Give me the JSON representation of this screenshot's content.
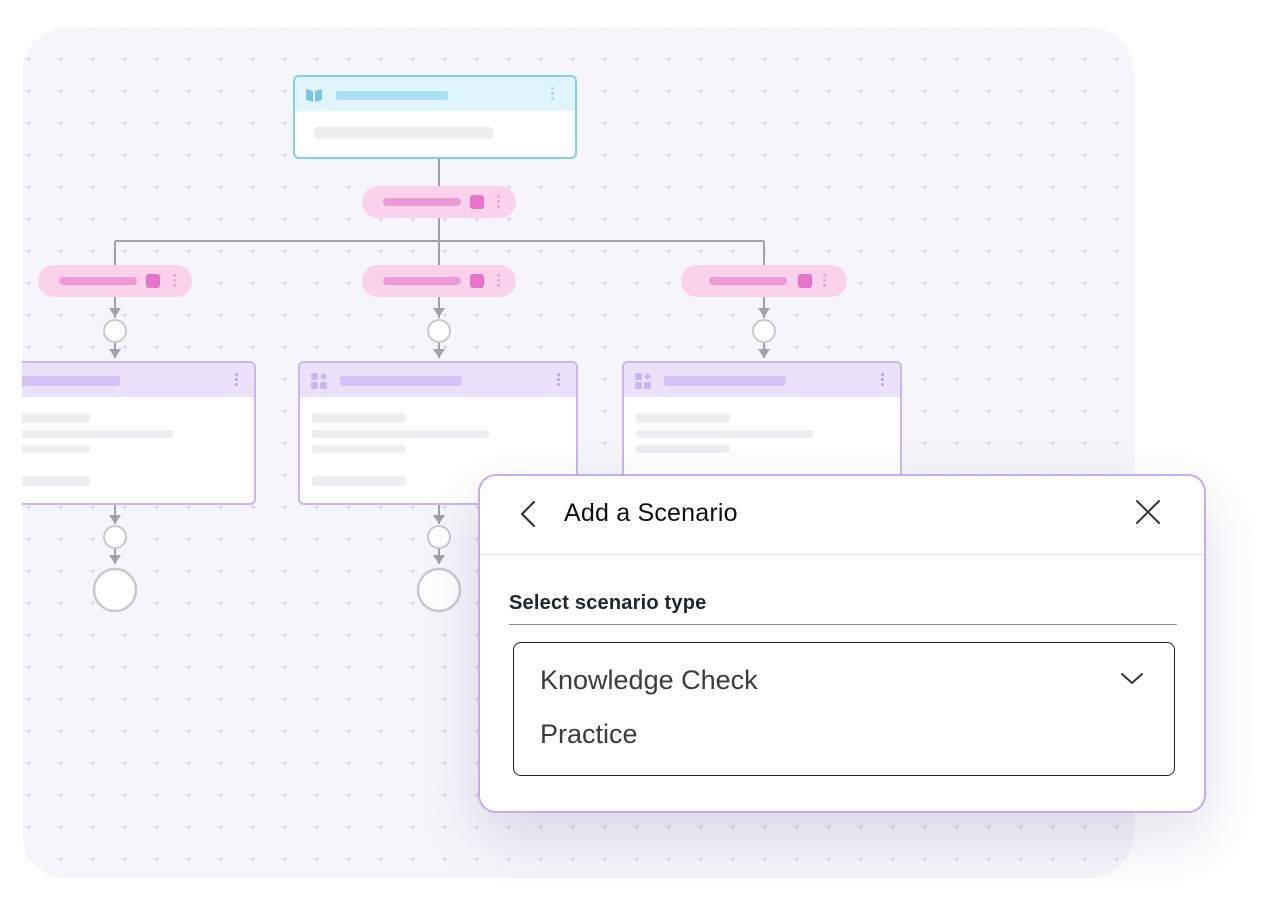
{
  "modal": {
    "title": "Add a Scenario",
    "field_label": "Select scenario type",
    "select": {
      "options": [
        "Knowledge Check",
        "Practice"
      ]
    }
  },
  "icons": {
    "back": "chevron-left-icon",
    "close": "close-icon",
    "dropdown": "chevron-down-icon",
    "root_card": "book-icon",
    "scenario_card": "grid-sparkle-icon"
  },
  "colors": {
    "accent_purple": "#c9a9f2",
    "pill_pink": "#fbd2ec",
    "root_blue": "#7fd1ee",
    "canvas_bg": "#f5f5fb"
  }
}
